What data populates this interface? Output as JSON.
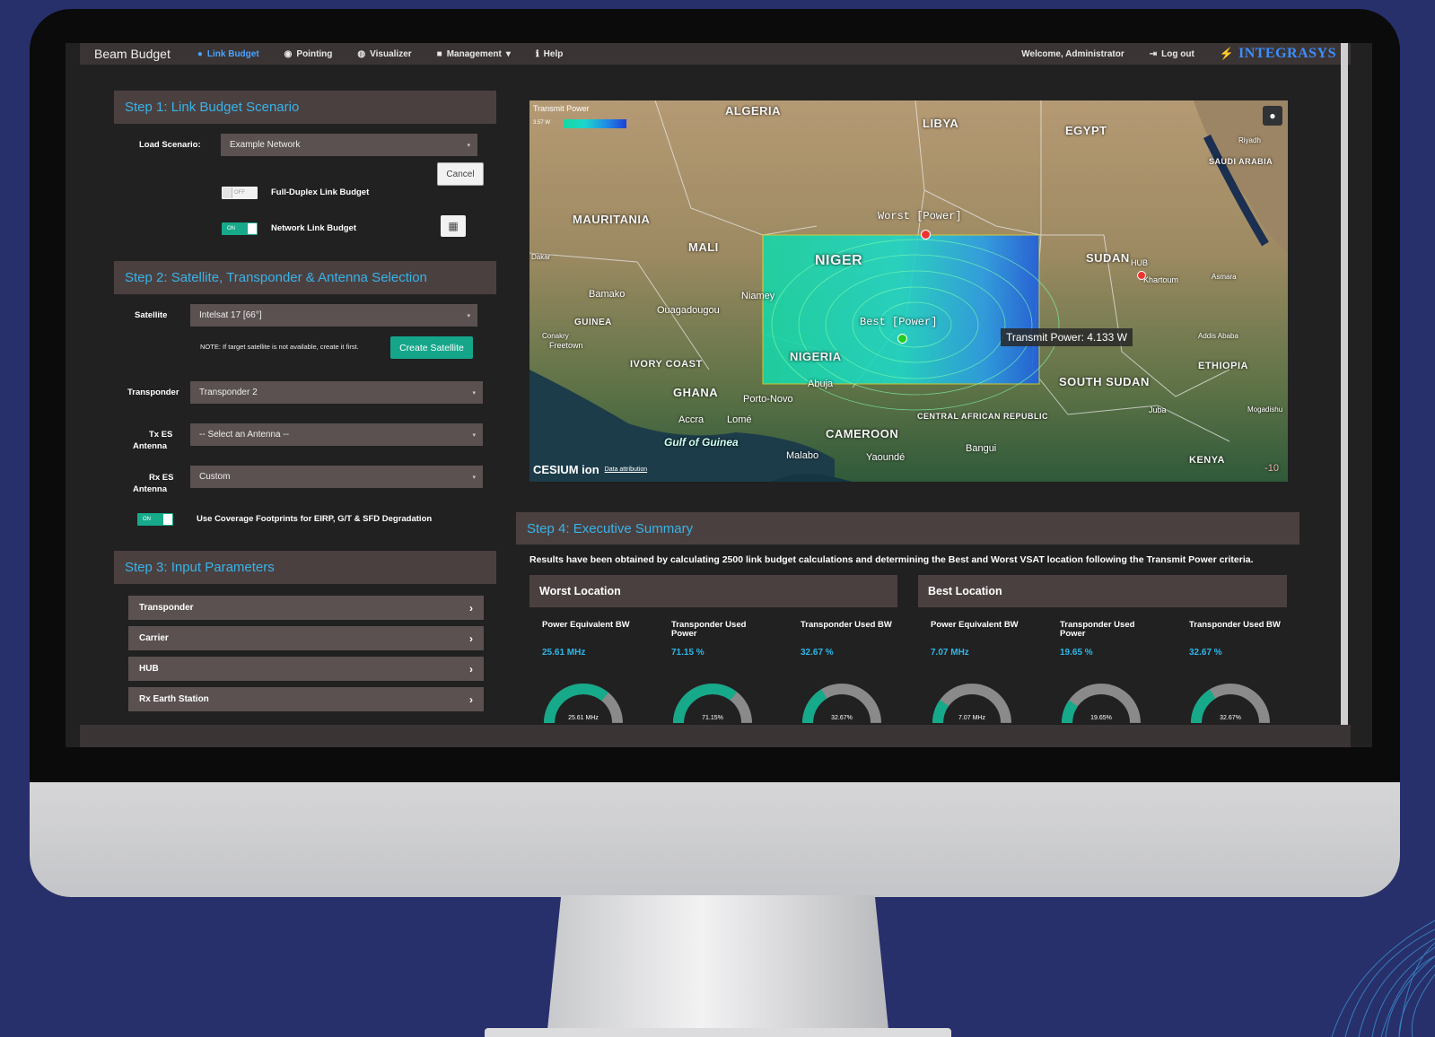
{
  "nav": {
    "brand": "Beam Budget",
    "items": [
      {
        "label": "Link Budget",
        "icon": "link-icon"
      },
      {
        "label": "Pointing",
        "icon": "dish-icon"
      },
      {
        "label": "Visualizer",
        "icon": "globe-icon"
      },
      {
        "label": "Management",
        "icon": "briefcase-icon"
      },
      {
        "label": "Help",
        "icon": "info-icon"
      }
    ],
    "welcome": "Welcome, Administrator",
    "logout": "Log out",
    "logo": "INTEGRASYS"
  },
  "step1": {
    "title": "Step 1: Link Budget Scenario",
    "load_label": "Load Scenario:",
    "load_value": "Example Network",
    "cancel": "Cancel",
    "full_duplex": {
      "label": "Full-Duplex Link Budget",
      "state": "OFF"
    },
    "network": {
      "label": "Network Link Budget",
      "state": "ON"
    }
  },
  "step2": {
    "title": "Step 2: Satellite, Transponder & Antenna Selection",
    "satellite_label": "Satellite",
    "satellite_value": "Intelsat 17 [66°]",
    "note": "NOTE: If target satellite is not available, create it first.",
    "create_satellite": "Create Satellite",
    "transponder_label": "Transponder",
    "transponder_value": "Transponder 2",
    "tx_label_1": "Tx ES",
    "tx_label_2": "Antenna",
    "tx_value": "-- Select an Antenna --",
    "rx_label_1": "Rx ES",
    "rx_label_2": "Antenna",
    "rx_value": "Custom",
    "coverage": {
      "label": "Use Coverage Footprints for EIRP, G/T & SFD Degradation",
      "state": "ON"
    }
  },
  "step3": {
    "title": "Step 3: Input Parameters",
    "items": [
      "Transponder",
      "Carrier",
      "HUB",
      "Rx Earth Station"
    ]
  },
  "map": {
    "legend_title": "Transmit Power",
    "legend_min": "3.57 W",
    "countries": [
      "ALGERIA",
      "LIBYA",
      "EGYPT",
      "MAURITANIA",
      "MALI",
      "NIGER",
      "SUDAN",
      "NIGERIA",
      "SOUTH SUDAN",
      "ETHIOPIA",
      "CAMEROON",
      "CENTRAL AFRICAN REPUBLIC",
      "GHANA",
      "IVORY COAST",
      "GUINEA",
      "KENYA",
      "SAUDI ARABIA"
    ],
    "cities": [
      "Bamako",
      "Niamey",
      "Ouagadougou",
      "Abuja",
      "Accra",
      "Lomé",
      "Porto-Novo",
      "Malabo",
      "Yaoundé",
      "Bangui",
      "Khartoum",
      "Juba",
      "Addis Ababa",
      "Freetown",
      "Conakry",
      "Dakar",
      "Asmara",
      "Riyadh",
      "Mogadishu"
    ],
    "sea": "Gulf of Guinea",
    "worst_marker": "Worst [Power]",
    "best_marker": "Best [Power]",
    "hub_marker": "HUB",
    "tooltip": "Transmit Power: 4.133 W",
    "cesium": "CESIUM ion",
    "attribution": "Data attribution",
    "scale_edge": "-10"
  },
  "step4": {
    "title": "Step 4: Executive Summary",
    "summary": "Results have been obtained by calculating 2500 link budget calculations and determining the Best and Worst VSAT location following the Transmit Power criteria.",
    "worst": {
      "title": "Worst Location",
      "metrics": [
        {
          "label": "Power Equivalent BW",
          "value": "25.61 MHz",
          "gauge": "25.61 MHz",
          "fraction": 0.72
        },
        {
          "label": "Transponder Used Power",
          "value": "71.15 %",
          "gauge": "71.15%",
          "fraction": 0.7115
        },
        {
          "label": "Transponder Used BW",
          "value": "32.67 %",
          "gauge": "32.67%",
          "fraction": 0.3267
        }
      ]
    },
    "best": {
      "title": "Best Location",
      "metrics": [
        {
          "label": "Power Equivalent BW",
          "value": "7.07 MHz",
          "gauge": "7.07 MHz",
          "fraction": 0.2
        },
        {
          "label": "Transponder Used Power",
          "value": "19.65 %",
          "gauge": "19.65%",
          "fraction": 0.1965
        },
        {
          "label": "Transponder Used BW",
          "value": "32.67 %",
          "gauge": "32.67%",
          "fraction": 0.3267
        }
      ]
    }
  },
  "colors": {
    "accent": "#2fb6e8",
    "teal": "#16a98a",
    "panel": "#4b4040",
    "background": "#27306b"
  }
}
